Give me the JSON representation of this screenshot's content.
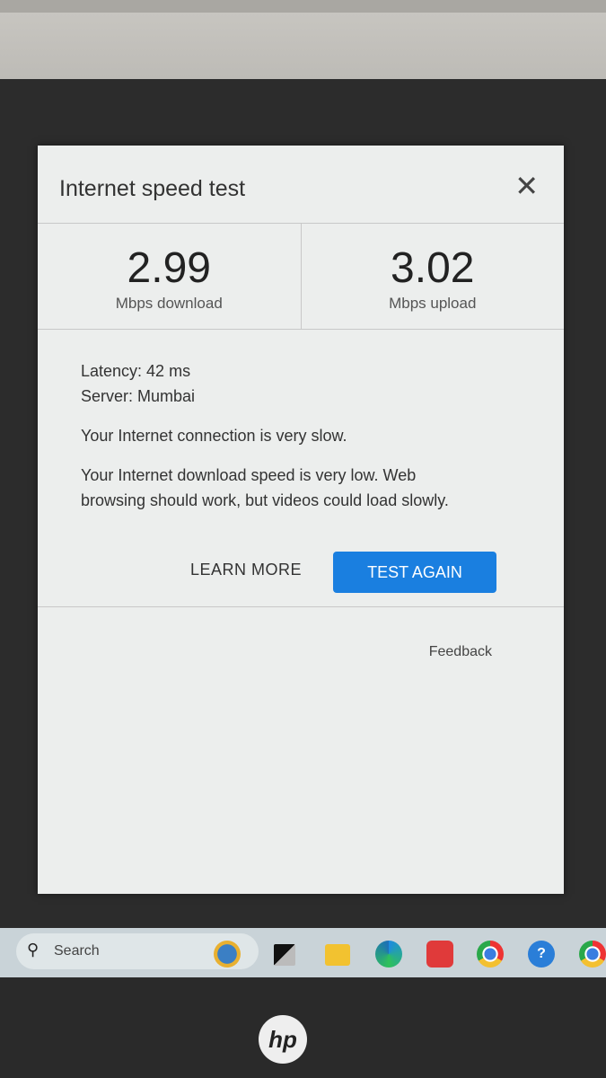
{
  "dialog": {
    "title": "Internet speed test",
    "close_icon": "close-icon",
    "download": {
      "value": "2.99",
      "unit": "Mbps download"
    },
    "upload": {
      "value": "3.02",
      "unit": "Mbps upload"
    },
    "latency": "Latency: 42 ms",
    "server": "Server: Mumbai",
    "summary": "Your Internet connection is very slow.",
    "detail": "Your Internet download speed is very low. Web browsing should work, but videos could load slowly.",
    "learn_more": "LEARN MORE",
    "test_again": "TEST AGAIN",
    "feedback": "Feedback",
    "accent": "#1a7fe0"
  },
  "taskbar": {
    "search_label": "Search",
    "icons": [
      "widgets-earth-icon",
      "task-view-icon",
      "file-explorer-icon",
      "edge-icon",
      "vivaldi-icon",
      "chrome-icon",
      "help-icon",
      "chrome-icon"
    ]
  },
  "device": {
    "logo": "hp"
  }
}
